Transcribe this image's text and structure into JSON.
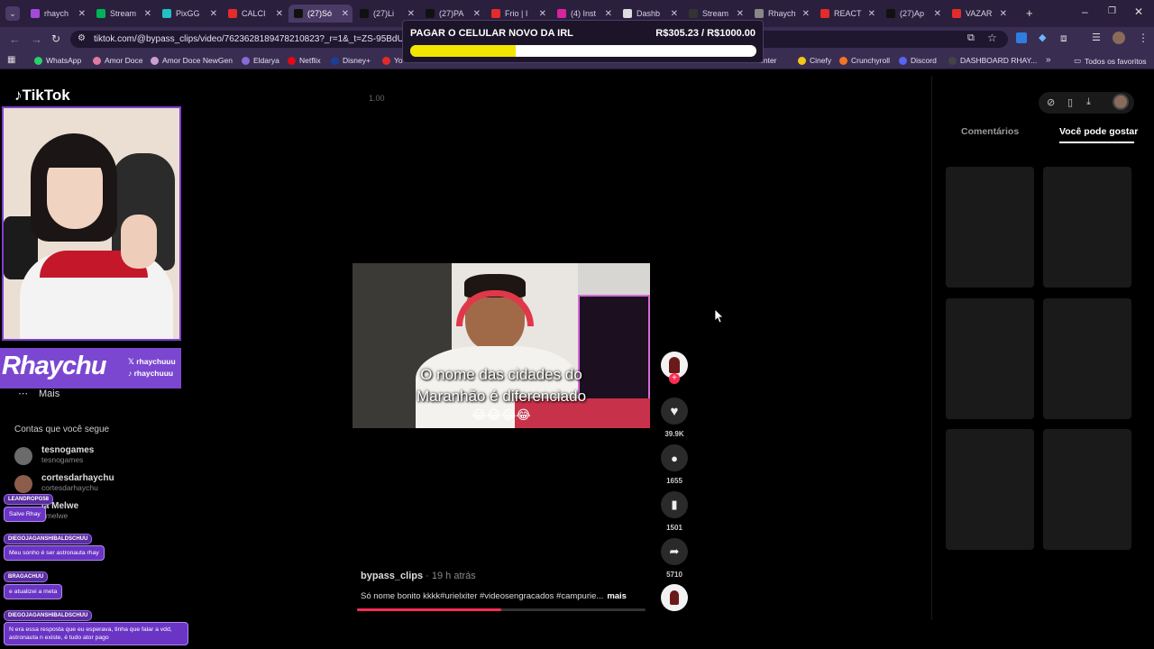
{
  "browser": {
    "tabs": [
      {
        "label": "rhaych",
        "color": "#a44ad8"
      },
      {
        "label": "Stream",
        "color": "#00b35a"
      },
      {
        "label": "PixGG",
        "color": "#22c1c3"
      },
      {
        "label": "CALCI",
        "color": "#e32b2b"
      },
      {
        "label": "(27)Só",
        "color": "#111111",
        "active": true
      },
      {
        "label": "(27)Li",
        "color": "#111111"
      },
      {
        "label": "(27)PA",
        "color": "#111111"
      },
      {
        "label": "Frio | I",
        "color": "#e32b2b"
      },
      {
        "label": "(4) Inst",
        "color": "#d6249f"
      },
      {
        "label": "Dashb",
        "color": "#dddddd"
      },
      {
        "label": "Stream",
        "color": "#333333"
      },
      {
        "label": "Rhaych",
        "color": "#888888"
      },
      {
        "label": "REACT",
        "color": "#e32b2b"
      },
      {
        "label": "(27)Ap",
        "color": "#111111"
      },
      {
        "label": "VAZAR",
        "color": "#e32b2b"
      }
    ],
    "url": "tiktok.com/@bypass_clips/video/7623628189478210823?_r=1&_t=ZS-95BdUUNfxe",
    "bookmarks_left": [
      {
        "label": "WhatsApp",
        "color": "#25d366"
      },
      {
        "label": "Amor Doce",
        "color": "#e07aa0"
      },
      {
        "label": "Amor Doce NewGen",
        "color": "#c9a0d0"
      },
      {
        "label": "Eldarya",
        "color": "#8a6ad6"
      },
      {
        "label": "Netflix",
        "color": "#e50914"
      },
      {
        "label": "Disney+",
        "color": "#1a3e9a"
      },
      {
        "label": "Yo",
        "color": "#e32b2b"
      }
    ],
    "bookmarks_right": [
      {
        "label": "Center",
        "color": "#3a2d52"
      },
      {
        "label": "Cinefy",
        "color": "#f5c518"
      },
      {
        "label": "Crunchyroll",
        "color": "#f47521"
      },
      {
        "label": "Discord",
        "color": "#5865f2"
      },
      {
        "label": "DASHBOARD RHAY...",
        "color": "#444444"
      }
    ],
    "favorites_label": "Todos os favoritos"
  },
  "donation": {
    "title": "PAGAR O CELULAR NOVO DA IRL",
    "amount": "R$305.23 / R$1000.00",
    "progress_percent": 30.5
  },
  "tiktok": {
    "logo": "TikTok",
    "speed": "1.00",
    "video_caption_line1": "O nome das cidades do",
    "video_caption_line2": "Maranhão é diferenciado",
    "video_emojis": "😂😂😂😂",
    "likes": "39.9K",
    "comments": "1655",
    "saves": "1501",
    "shares": "5710",
    "author": "bypass_clips",
    "time_ago": "· 19 h atrás",
    "description": "Só nome bonito kkkk#urielxiter #videosengracados #campurie...",
    "more": "mais",
    "progress_percent": 50
  },
  "sidebar": {
    "more": "Mais",
    "following_title": "Contas que você segue",
    "accounts": [
      {
        "name": "tesnogames",
        "handle": "tesnogames"
      },
      {
        "name": "cortesdarhaychu",
        "handle": "cortesdarhaychu"
      },
      {
        "name": "ia Melwe",
        "handle": "amelwe"
      }
    ]
  },
  "overlay": {
    "brand_name": "Rhaychu",
    "brand_x": "rhaychuuu",
    "brand_tiktok": "rhaychuuu"
  },
  "chat": [
    {
      "user": "LEANDROPG58",
      "message": "Salve Rhay"
    },
    {
      "user": "DIEGOJAGANSHIBALDSCHUU",
      "message": "Meu sonho é ser astronauta rhay"
    },
    {
      "user": "BRAGACHUU",
      "message": "e atualizei a meta"
    },
    {
      "user": "DIEGOJAGANSHIBALDSCHUU",
      "message": "N era essa resposta que eu esperava, tinha que falar a vdd, astronauta n existe, é tudo ator pago"
    }
  ],
  "right_panel": {
    "tab_comments": "Comentários",
    "tab_likes": "Você pode gostar"
  }
}
